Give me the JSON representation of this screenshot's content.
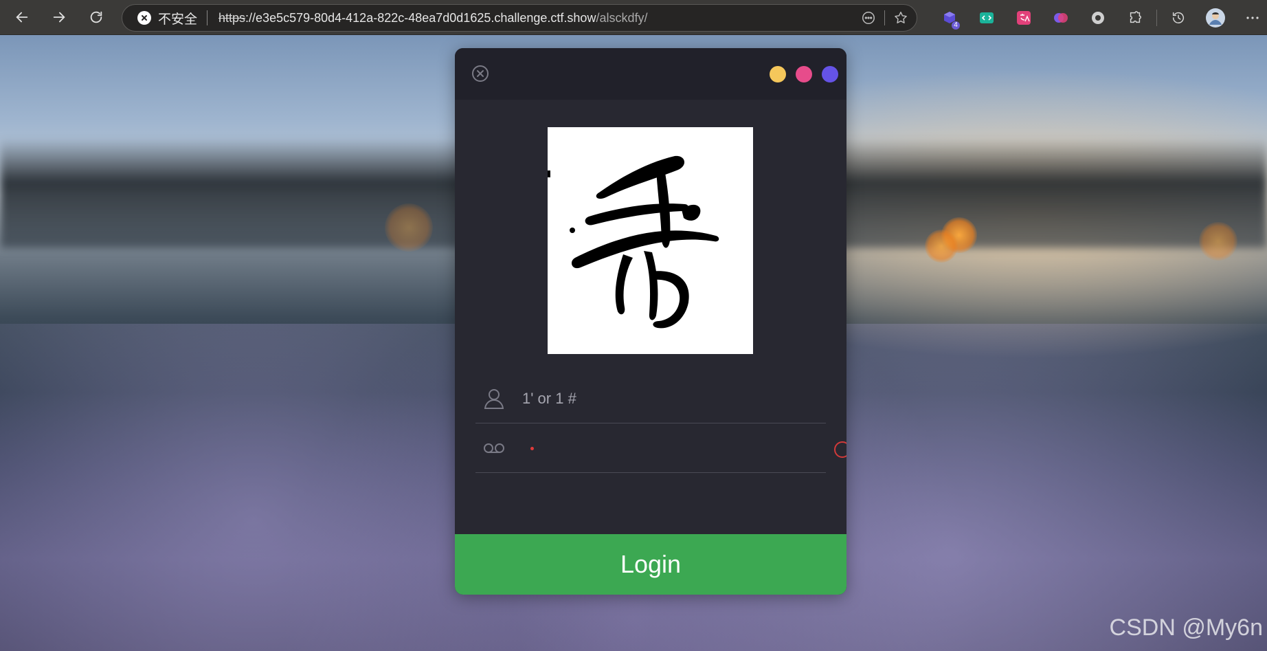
{
  "browser": {
    "security_label": "不安全",
    "url_scheme": "https",
    "url_host": "://e3e5c579-80d4-412a-822c-48ea7d0d1625.challenge.ctf.show",
    "url_path": "/alsckdfy/",
    "ext_badge_count": "4"
  },
  "login": {
    "username_value": "1' or 1 #",
    "button_label": "Login",
    "dot_colors": [
      "#f5c75b",
      "#e74c8b",
      "#6553e6"
    ],
    "button_color": "#3ca852"
  },
  "watermark": "CSDN @My6n"
}
